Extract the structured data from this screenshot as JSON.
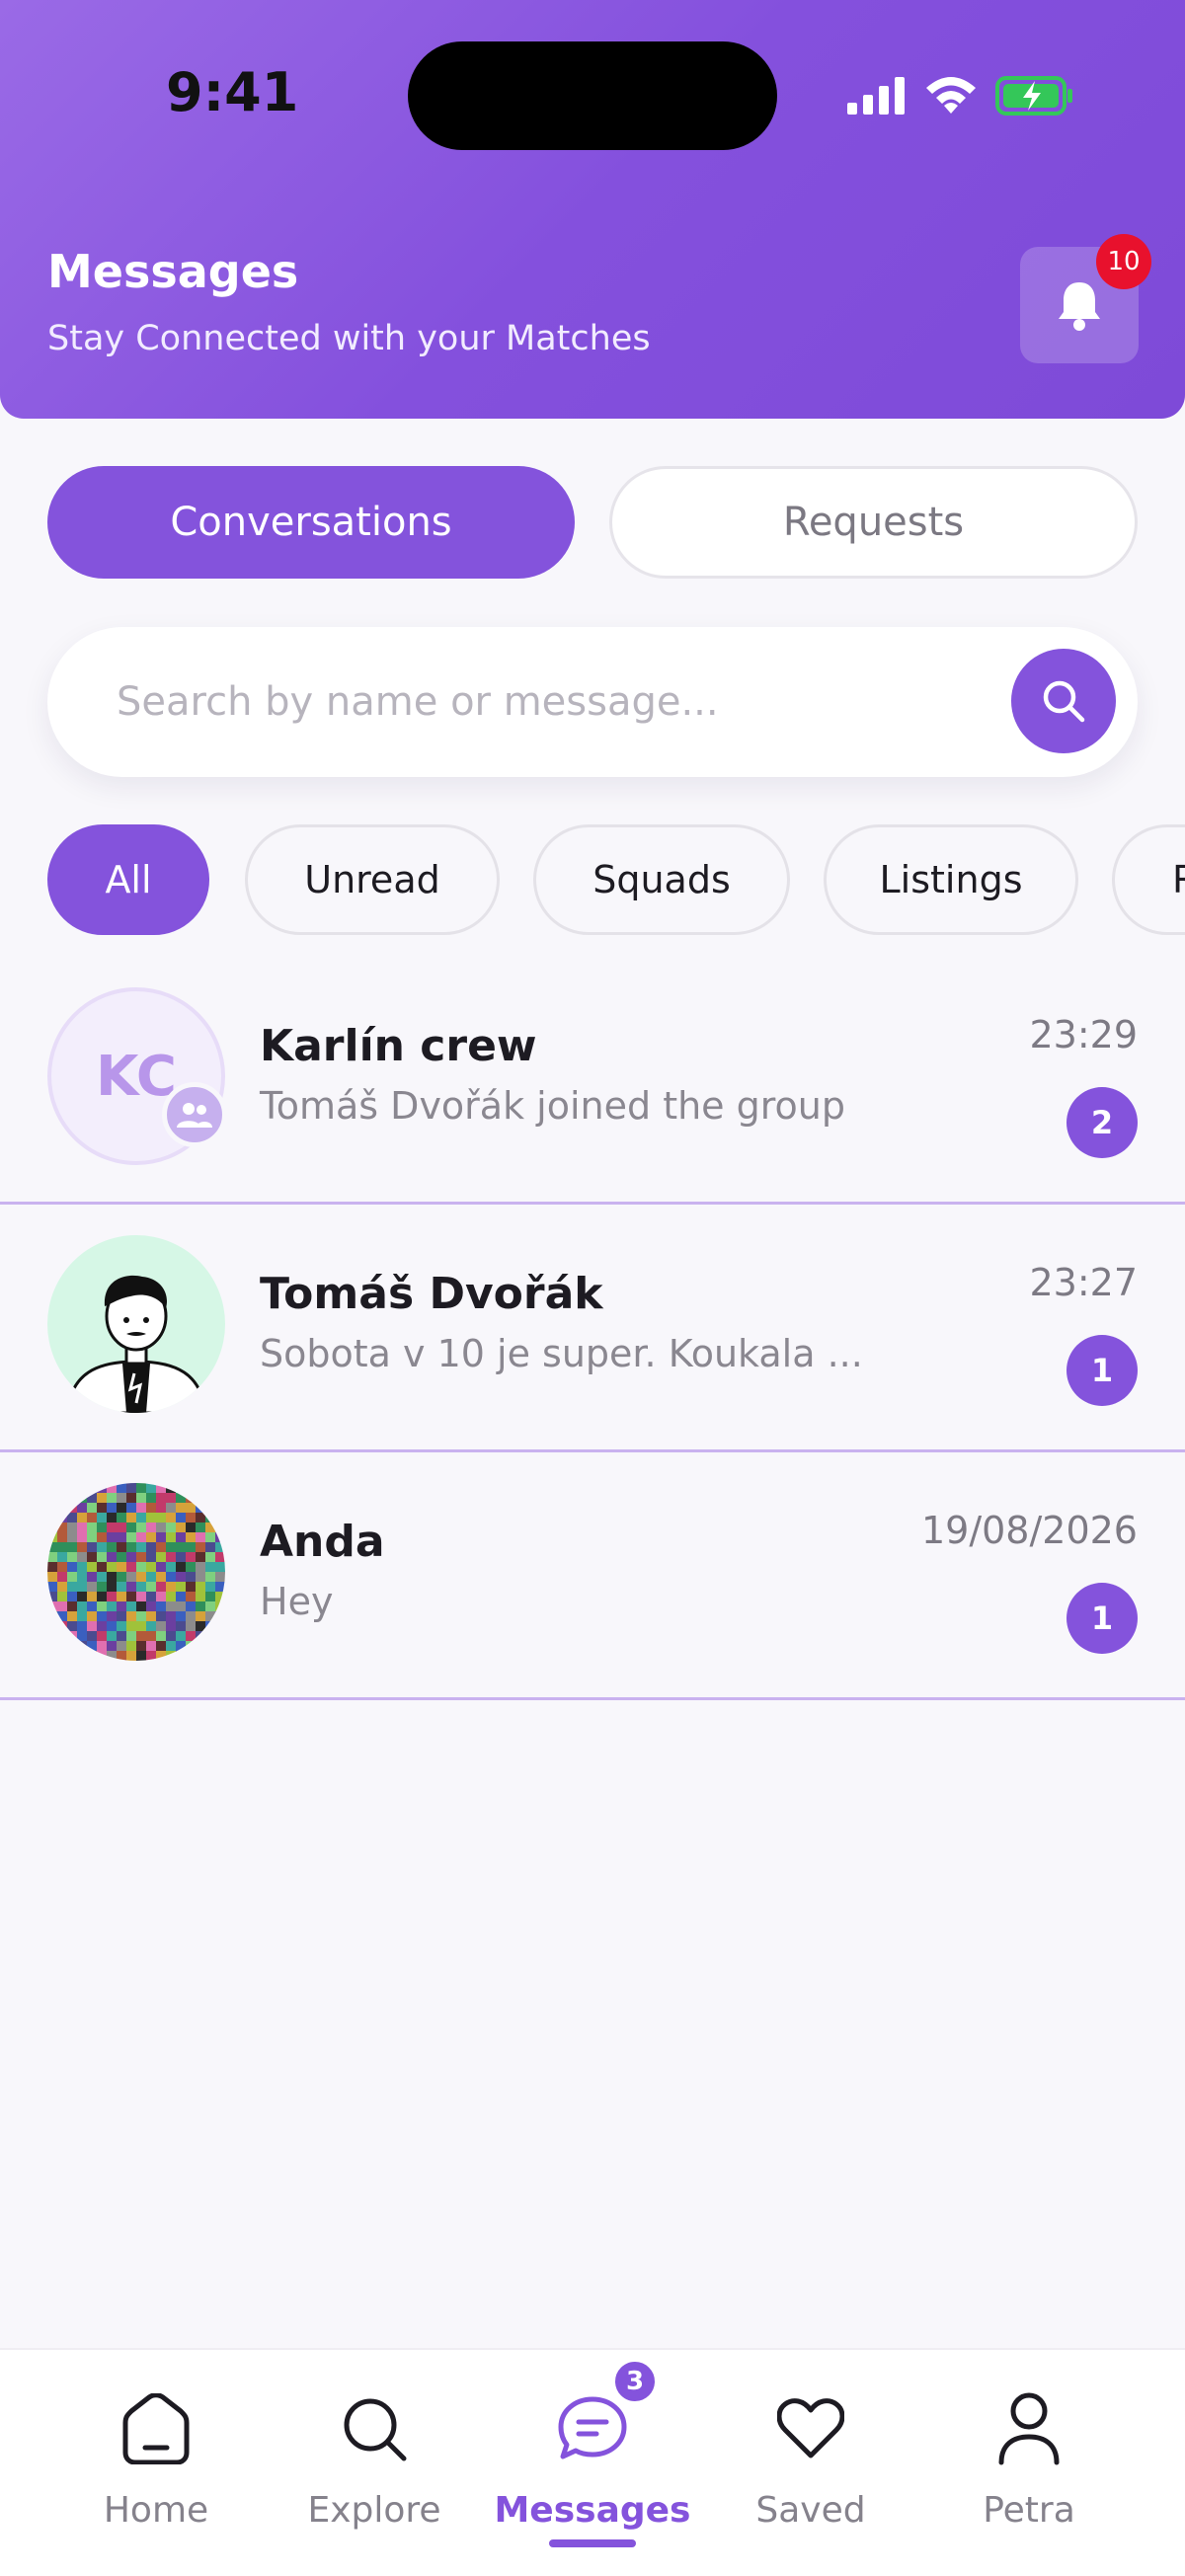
{
  "status_bar": {
    "time": "9:41"
  },
  "header": {
    "title": "Messages",
    "subtitle": "Stay Connected with your Matches",
    "notification_count": "10"
  },
  "tabs": [
    {
      "label": "Conversations",
      "active": true
    },
    {
      "label": "Requests",
      "active": false
    }
  ],
  "search": {
    "placeholder": "Search by name or message..."
  },
  "filters": [
    {
      "label": "All",
      "active": true
    },
    {
      "label": "Unread",
      "active": false
    },
    {
      "label": "Squads",
      "active": false
    },
    {
      "label": "Listings",
      "active": false
    },
    {
      "label": "R",
      "active": false
    }
  ],
  "conversations": [
    {
      "name": "Karlín crew",
      "preview": "Tomáš Dvořák joined the group",
      "time": "23:29",
      "unread": "2",
      "avatar_initials": "KC",
      "is_group": true
    },
    {
      "name": "Tomáš Dvořák",
      "preview": "Sobota v 10 je super. Koukala ...",
      "time": "23:27",
      "unread": "1",
      "avatar": "cartoon-illustration"
    },
    {
      "name": "Anda",
      "preview": "Hey",
      "time": "19/08/2026",
      "unread": "1",
      "avatar": "pixel-mosaic"
    }
  ],
  "bottom_nav": {
    "items": [
      {
        "label": "Home",
        "icon": "home-icon"
      },
      {
        "label": "Explore",
        "icon": "search-icon"
      },
      {
        "label": "Messages",
        "icon": "chat-icon",
        "active": true
      },
      {
        "label": "Saved",
        "icon": "heart-icon"
      },
      {
        "label": "Petra",
        "icon": "user-icon"
      }
    ],
    "messages_badge": "3"
  },
  "colors": {
    "accent": "#8453dc",
    "header_gradient_start": "#9a6ae6",
    "notification_badge": "#e8112d"
  }
}
